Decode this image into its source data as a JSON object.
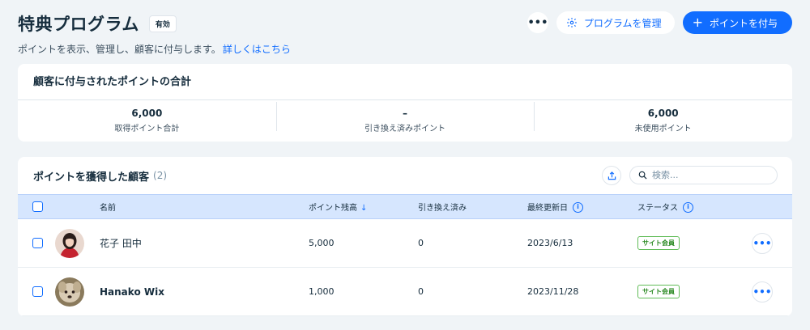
{
  "header": {
    "title": "特典プログラム",
    "status_badge": "有効",
    "subtitle": "ポイントを表示、管理し、顧客に付与します。",
    "learn_more": "詳しくはこちら",
    "more_icon": "•••",
    "manage_label": "プログラムを管理",
    "give_points_label": "ポイントを付与",
    "give_points_plus": "+"
  },
  "summary": {
    "title": "顧客に付与されたポイントの合計",
    "stats": [
      {
        "value": "6,000",
        "label": "取得ポイント合計"
      },
      {
        "value": "–",
        "label": "引き換え済みポイント"
      },
      {
        "value": "6,000",
        "label": "未使用ポイント"
      }
    ]
  },
  "customers": {
    "title": "ポイントを獲得した顧客",
    "count": "(2)",
    "search_placeholder": "検索...",
    "columns": {
      "name": "名前",
      "points": "ポイント残高",
      "sort_arrow": "↓",
      "redeemed": "引き換え済み",
      "updated": "最終更新日",
      "status": "ステータス",
      "info_glyph": "i"
    },
    "rows": [
      {
        "name": "花子 田中",
        "points": "5,000",
        "redeemed": "0",
        "updated": "2023/6/13",
        "status": "サイト会員",
        "more": "•••"
      },
      {
        "name": "Hanako Wix",
        "points": "1,000",
        "redeemed": "0",
        "updated": "2023/11/28",
        "status": "サイト会員",
        "more": "•••"
      }
    ]
  },
  "colors": {
    "accent": "#116dff",
    "background": "#f0f4f7",
    "table_header": "#d6e6fe",
    "status_green": "#60bc57"
  },
  "icons": {
    "manage": "gear-icon",
    "give": "plus-icon",
    "export": "export-icon",
    "search": "search-icon",
    "info": "info-icon",
    "more": "more-icon"
  }
}
